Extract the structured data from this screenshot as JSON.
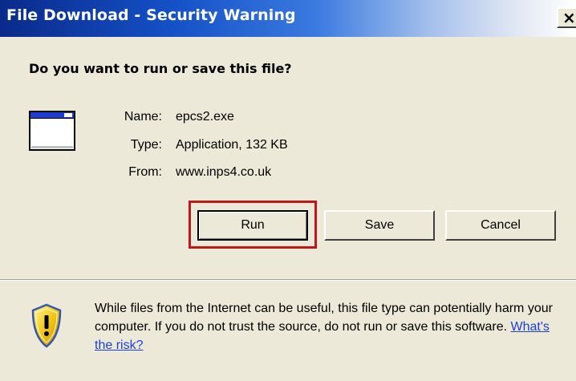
{
  "window": {
    "title": "File Download - Security Warning",
    "close_label": "×"
  },
  "dialog": {
    "question": "Do you want to run or save this file?",
    "icon": "application-window-icon",
    "fields": [
      {
        "label": "Name:",
        "value": "epcs2.exe"
      },
      {
        "label": "Type:",
        "value": "Application, 132 KB"
      },
      {
        "label": "From:",
        "value": "www.inps4.co.uk"
      }
    ]
  },
  "buttons": {
    "run": "Run",
    "save": "Save",
    "cancel": "Cancel"
  },
  "warning": {
    "icon": "shield-warning-icon",
    "text": "While files from the Internet can be useful, this file type can potentially harm your computer. If you do not trust the source, do not run or save this software.",
    "link": "What's the risk?"
  },
  "colors": {
    "highlight": "#c0181a",
    "link": "#1a3fd8",
    "titlebar": "#1451c7"
  }
}
